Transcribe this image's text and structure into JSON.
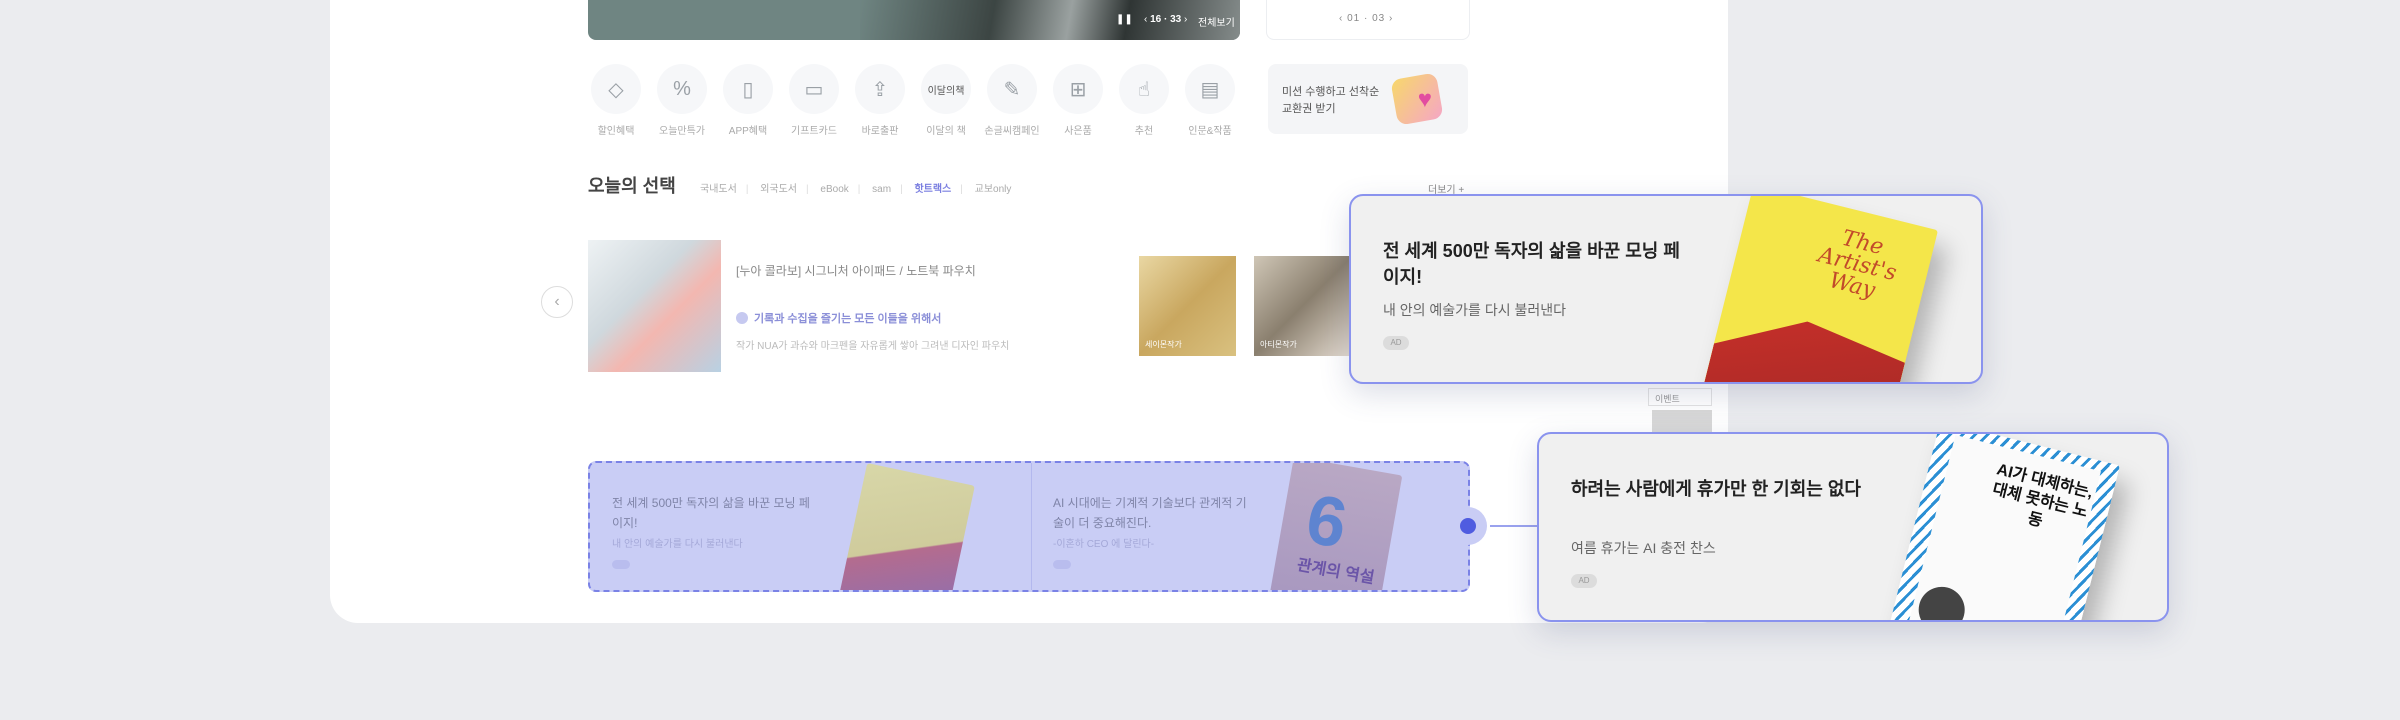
{
  "hero": {
    "pager": "16 · 33",
    "all_label": "전체보기"
  },
  "side_panel": {
    "pager": "01 · 03"
  },
  "quick_menu": [
    {
      "label": "할인혜택",
      "icon": "diamond-icon"
    },
    {
      "label": "오늘만특가",
      "icon": "percent-icon"
    },
    {
      "label": "APP혜택",
      "icon": "phone-icon"
    },
    {
      "label": "기프트카드",
      "icon": "gift-card-icon"
    },
    {
      "label": "바로출판",
      "icon": "book-upload-icon"
    },
    {
      "label": "이달의 책",
      "icon": "monthly-book-icon"
    },
    {
      "label": "손글씨캠페인",
      "icon": "pen-icon"
    },
    {
      "label": "사은품",
      "icon": "present-icon"
    },
    {
      "label": "추천",
      "icon": "thumbs-up-icon"
    },
    {
      "label": "인문&작품",
      "icon": "document-icon"
    }
  ],
  "mission": {
    "text": "미션 수행하고 선착순 교환권 받기"
  },
  "today_section": {
    "title": "오늘의 선택",
    "tabs": [
      "국내도서",
      "외국도서",
      "eBook",
      "sam",
      "핫트랙스",
      "교보only"
    ],
    "active_tab": "핫트랙스",
    "more_label": "더보기 +"
  },
  "product": {
    "title": "[누아 콜라보] 시그니처 아이패드 / 노트북 파우치",
    "subtitle": "기록과 수집을 즐기는 모든 이들을 위해서",
    "description": "작가 NUA가 과슈와 마크펜을 자유롭게 쌓아 그려낸 디자인 파우치"
  },
  "thumbs": [
    {
      "caption": "세이몬작가"
    },
    {
      "caption": "아티몬작가"
    }
  ],
  "mini_select": "이벤트",
  "ad_slot": [
    {
      "title": "전 세계 500만 독자의 삶을 바꾼 모닝 페이지!",
      "subtitle": "내 안의 예술가를 다시 불러낸다"
    },
    {
      "title": "AI 시대에는 기계적 기술보다 관계적 기술이 더 중요해진다.",
      "subtitle": "-이혼하 CEO 에 달린다-"
    }
  ],
  "book_b": {
    "number": "6",
    "title": "관계의 역설"
  },
  "cards": [
    {
      "title": "전 세계 500만 독자의 삶을 바꾼 모닝 페이지!",
      "subtitle": "내 안의 예술가를 다시 불러낸다",
      "badge": "AD",
      "cover_title": "The Artist's Way"
    },
    {
      "title": "하려는 사람에게 휴가만 한 기회는 없다",
      "subtitle": "여름 휴가는 AI 충전 찬스",
      "badge": "AD",
      "cover_title": "AI가 대체하는, 대체 못하는 노동"
    }
  ],
  "colors": {
    "background": "#ebecef",
    "accent": "#4f5ce0",
    "slot_fill": "#c9cdf5",
    "card_border": "#8a93ee"
  }
}
